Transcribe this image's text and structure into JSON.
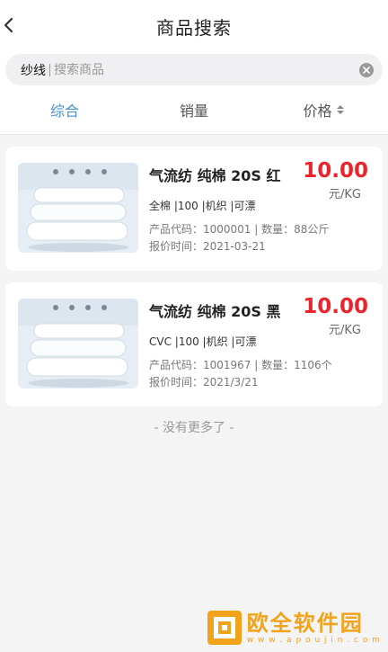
{
  "header": {
    "title": "商品搜索"
  },
  "search": {
    "keyword": "纱线",
    "placeholder": "搜索商品"
  },
  "tabs": [
    {
      "label": "综合",
      "active": true
    },
    {
      "label": "销量",
      "active": false
    },
    {
      "label": "价格",
      "active": false
    }
  ],
  "products": [
    {
      "name": "气流纺 纯棉 20S 红",
      "spec": "全棉 |100 |机织 |可漂",
      "code_line": "产品代码：1000001 | 数量：88公斤",
      "time_line": "报价时间：2021-03-21",
      "price": "10.00",
      "unit": "元/KG"
    },
    {
      "name": "气流纺 纯棉 20S 黑",
      "spec": "CVC |100 |机织 |可漂",
      "code_line": "产品代码：1001967 | 数量：1106个",
      "time_line": "报价时间：2021/3/21",
      "price": "10.00",
      "unit": "元/KG"
    }
  ],
  "footer": {
    "no_more": "- 没有更多了 -"
  },
  "watermark": {
    "name": "欧全软件园",
    "url": "w w w . a p o u j i n . c o m"
  },
  "colors": {
    "accent": "#4a8fd6",
    "price": "#e8262c",
    "watermark": "#f3a21b"
  }
}
